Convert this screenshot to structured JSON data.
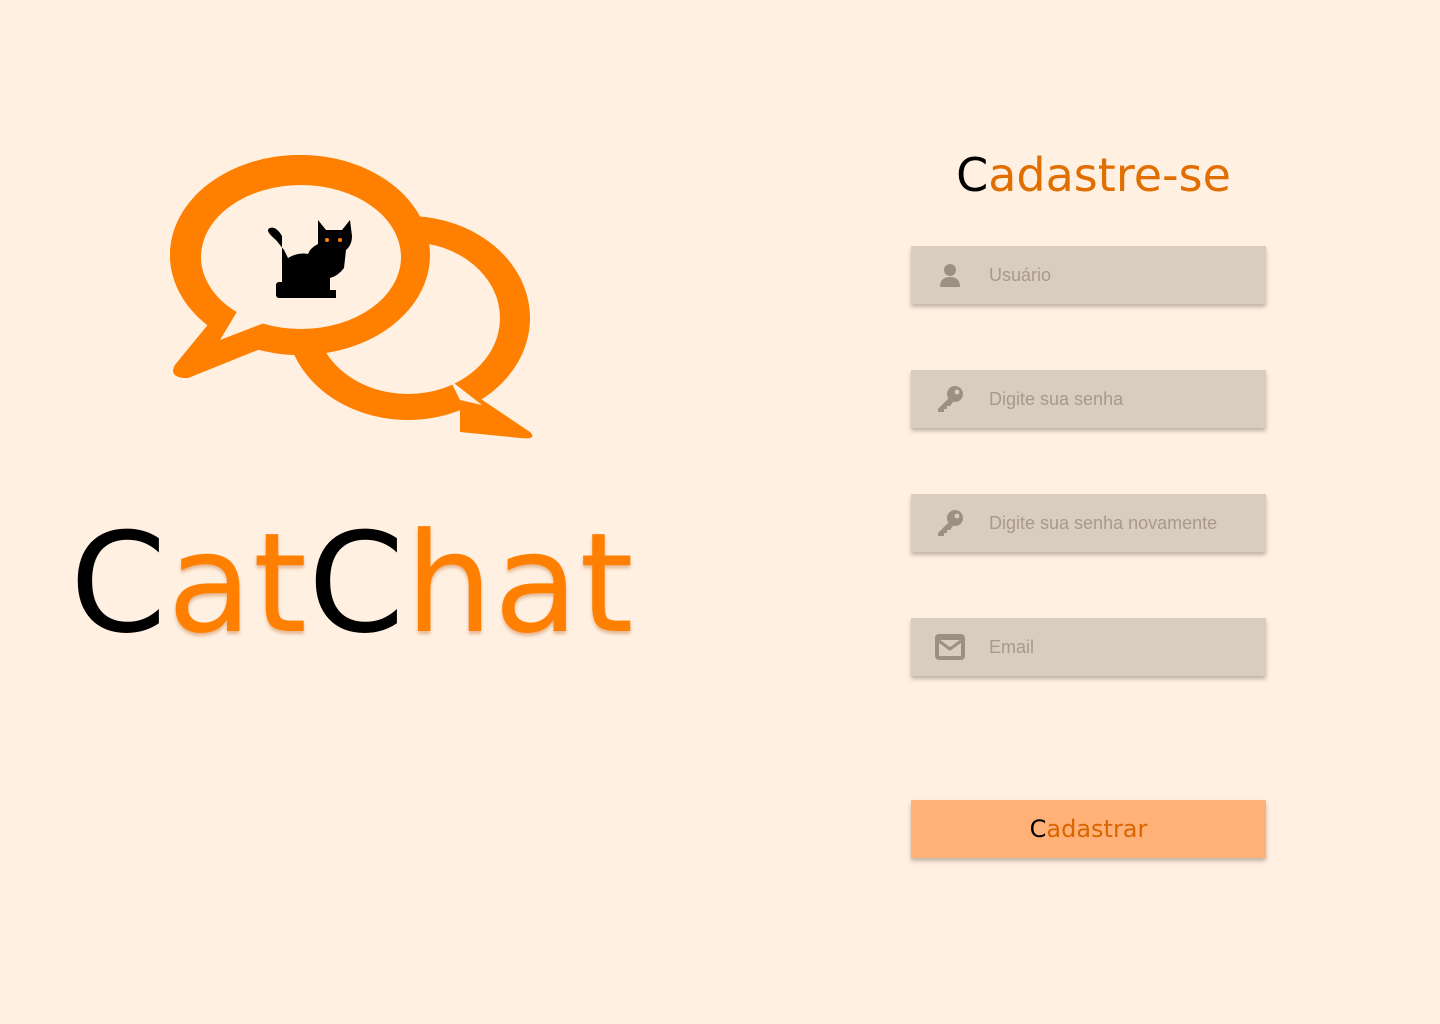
{
  "brand": {
    "first_c": "C",
    "first_rest": "at",
    "second_c": "C",
    "second_rest": "hat"
  },
  "signup": {
    "title_c": "C",
    "title_rest": "adastre-se",
    "fields": {
      "username": {
        "placeholder": "Usuário",
        "icon": "user-icon"
      },
      "password": {
        "placeholder": "Digite sua senha",
        "icon": "key-icon"
      },
      "password_confirm": {
        "placeholder": "Digite sua senha novamente",
        "icon": "key-icon"
      },
      "email": {
        "placeholder": "Email",
        "icon": "envelope-icon"
      }
    },
    "submit_c": "C",
    "submit_rest": "adastrar"
  },
  "colors": {
    "background": "#fff0e1",
    "accent": "#ff7f00",
    "field_bg": "#d9cdbf",
    "button_bg": "#ffb178"
  }
}
